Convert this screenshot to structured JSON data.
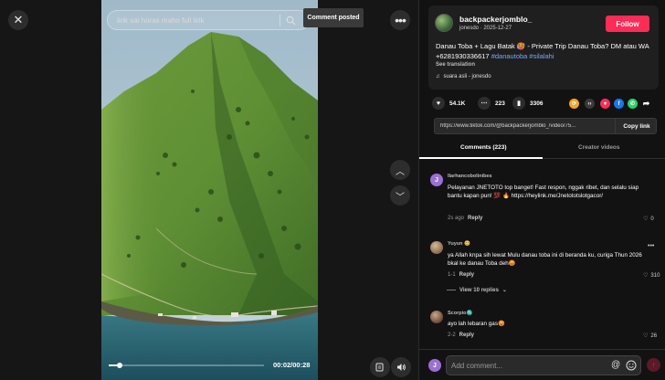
{
  "video": {
    "search_placeholder": "lirik sai horas maho fuli lirik",
    "comment_posted": "Comment posted",
    "time": "00:02/00:28",
    "progress": 0.07
  },
  "nav": {
    "close_icon": "close-icon",
    "more_icon": "more-icon",
    "prev_icon": "chevron-up-icon",
    "next_icon": "chevron-down-icon"
  },
  "post": {
    "username": "backpackerjomblo_",
    "subline": "jonesdo · 2025-12-27",
    "follow_label": "Follow",
    "description_text": "Danau Toba + Lagu Batak 🥵 - Private Trip Danau Toba? DM atau WA +6281930336617 ",
    "hashtags": "#danautoba #silalahi",
    "see_translation": "See translation",
    "music": "suara asli - jonesdo",
    "likes": "54.1K",
    "comments": "223",
    "saves": "3306",
    "link": "https://www.tiktok.com/@backpackerjomblo_/video/75...",
    "copy_link": "Copy link",
    "share_colors": [
      "#f5a623",
      "#3a3a3a",
      "#fe2c55",
      "#1877f2",
      "#25d366"
    ]
  },
  "tabs": {
    "comments": "Comments (223)",
    "creator": "Creator videos"
  },
  "comments": [
    {
      "user": "llarhancobolinibes",
      "avatar_letter": "J",
      "avatar_color": "#9b6fd3",
      "text": "Pelayanan JNETOTO top banget! Fast respon, nggak ribet, dan selalu siap bantu kapan pun! 💯 🔥 https://heylink.me/Jnetototslotgacor/",
      "time": "2s ago",
      "reply": "Reply",
      "likes": "0"
    },
    {
      "user": "Yuyun 😊",
      "avatar_letter": "",
      "avatar_color": "#b09070",
      "text": "ya Allah knpa sih lewat Mulu danau toba ini di beranda ku, curiga Thun 2026 bkal ke danau Toba deh😡",
      "time": "1-1",
      "reply": "Reply",
      "likes": "310"
    },
    {
      "user": "Scorpio♏",
      "avatar_letter": "",
      "avatar_color": "#a08060",
      "text": "ayo lah lebaran gas😡",
      "time": "2-2",
      "reply": "Reply",
      "likes": "26"
    }
  ],
  "view_replies": "View 10 replies",
  "composer": {
    "avatar_letter": "J",
    "placeholder": "Add comment..."
  }
}
